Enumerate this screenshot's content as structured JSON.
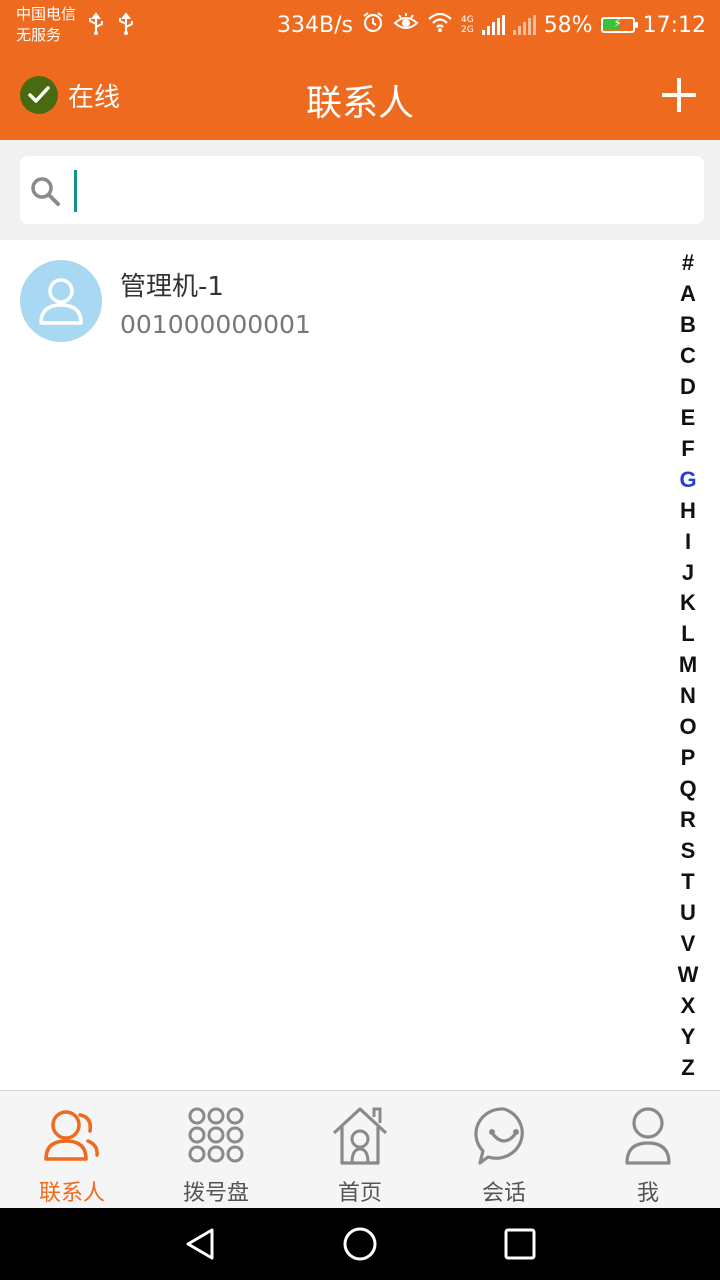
{
  "status_bar": {
    "carrier_line1": "中国电信",
    "carrier_line2": "无服务",
    "net_speed": "334B/s",
    "net_tag_top": "4G",
    "net_tag_bottom": "2G",
    "battery_percent": "58%",
    "battery_level": 0.58,
    "time": "17:12"
  },
  "header": {
    "status_label": "在线",
    "title": "联系人"
  },
  "search": {
    "placeholder": "",
    "value": ""
  },
  "contacts": [
    {
      "name": "管理机-1",
      "number": "001000000001"
    }
  ],
  "alphabet": {
    "letters": [
      "#",
      "A",
      "B",
      "C",
      "D",
      "E",
      "F",
      "G",
      "H",
      "I",
      "J",
      "K",
      "L",
      "M",
      "N",
      "O",
      "P",
      "Q",
      "R",
      "S",
      "T",
      "U",
      "V",
      "W",
      "X",
      "Y",
      "Z"
    ],
    "active": "G"
  },
  "tabs": [
    {
      "label": "联系人",
      "icon": "contacts-icon",
      "active": true
    },
    {
      "label": "拨号盘",
      "icon": "dialpad-icon",
      "active": false
    },
    {
      "label": "首页",
      "icon": "home-icon",
      "active": false
    },
    {
      "label": "会话",
      "icon": "chat-icon",
      "active": false
    },
    {
      "label": "我",
      "icon": "profile-icon",
      "active": false
    }
  ],
  "colors": {
    "accent": "#ee6a1e",
    "online_green": "#4a6a12",
    "avatar_bg": "#a9d8f2",
    "index_active": "#1f3fd6",
    "caret": "#15938a"
  }
}
